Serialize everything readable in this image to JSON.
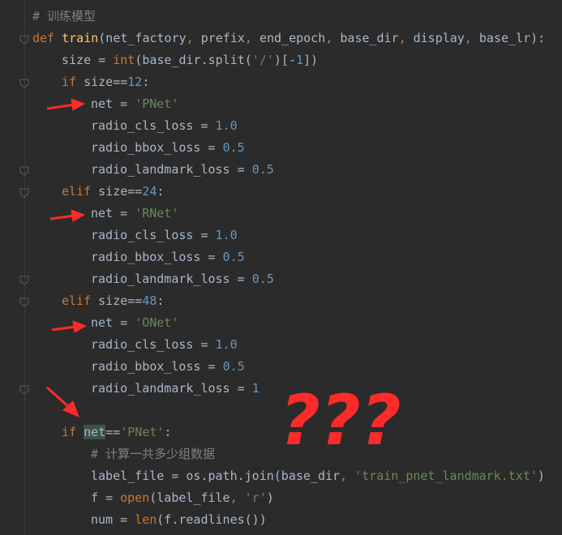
{
  "editor": {
    "lines": [
      {
        "indent": 0,
        "spans": [
          {
            "t": "# 训练模型",
            "c": "cm"
          }
        ]
      },
      {
        "indent": 0,
        "spans": [
          {
            "t": "def ",
            "c": "kw"
          },
          {
            "t": "train",
            "c": "fn"
          },
          {
            "t": "(net_factory",
            "c": ""
          },
          {
            "t": ", ",
            "c": "kw"
          },
          {
            "t": "prefix",
            "c": ""
          },
          {
            "t": ", ",
            "c": "kw"
          },
          {
            "t": "end_epoch",
            "c": ""
          },
          {
            "t": ", ",
            "c": "kw"
          },
          {
            "t": "base_dir",
            "c": ""
          },
          {
            "t": ", ",
            "c": "kw"
          },
          {
            "t": "display",
            "c": ""
          },
          {
            "t": ", ",
            "c": "kw"
          },
          {
            "t": "base_lr):",
            "c": ""
          }
        ]
      },
      {
        "indent": 1,
        "spans": [
          {
            "t": "size = ",
            "c": ""
          },
          {
            "t": "int",
            "c": "kw"
          },
          {
            "t": "(base_dir.split(",
            "c": ""
          },
          {
            "t": "'/'",
            "c": "str"
          },
          {
            "t": ")[-",
            "c": ""
          },
          {
            "t": "1",
            "c": "num"
          },
          {
            "t": "])",
            "c": ""
          }
        ]
      },
      {
        "indent": 1,
        "spans": [
          {
            "t": "if ",
            "c": "kw"
          },
          {
            "t": "size==",
            "c": ""
          },
          {
            "t": "12",
            "c": "num"
          },
          {
            "t": ":",
            "c": ""
          }
        ]
      },
      {
        "indent": 2,
        "spans": [
          {
            "t": "net = ",
            "c": ""
          },
          {
            "t": "'PNet'",
            "c": "str"
          }
        ]
      },
      {
        "indent": 2,
        "spans": [
          {
            "t": "radio_cls_loss = ",
            "c": ""
          },
          {
            "t": "1.0",
            "c": "num"
          }
        ]
      },
      {
        "indent": 2,
        "spans": [
          {
            "t": "radio_bbox_loss = ",
            "c": ""
          },
          {
            "t": "0.5",
            "c": "num"
          }
        ]
      },
      {
        "indent": 2,
        "spans": [
          {
            "t": "radio_landmark_loss = ",
            "c": ""
          },
          {
            "t": "0.5",
            "c": "num"
          }
        ]
      },
      {
        "indent": 1,
        "spans": [
          {
            "t": "elif ",
            "c": "kw"
          },
          {
            "t": "size==",
            "c": ""
          },
          {
            "t": "24",
            "c": "num"
          },
          {
            "t": ":",
            "c": ""
          }
        ]
      },
      {
        "indent": 2,
        "spans": [
          {
            "t": "net = ",
            "c": ""
          },
          {
            "t": "'RNet'",
            "c": "str"
          }
        ]
      },
      {
        "indent": 2,
        "spans": [
          {
            "t": "radio_cls_loss = ",
            "c": ""
          },
          {
            "t": "1.0",
            "c": "num"
          }
        ]
      },
      {
        "indent": 2,
        "spans": [
          {
            "t": "radio_bbox_loss = ",
            "c": ""
          },
          {
            "t": "0.5",
            "c": "num"
          }
        ]
      },
      {
        "indent": 2,
        "spans": [
          {
            "t": "radio_landmark_loss = ",
            "c": ""
          },
          {
            "t": "0.5",
            "c": "num"
          }
        ]
      },
      {
        "indent": 1,
        "spans": [
          {
            "t": "elif ",
            "c": "kw"
          },
          {
            "t": "size==",
            "c": ""
          },
          {
            "t": "48",
            "c": "num"
          },
          {
            "t": ":",
            "c": ""
          }
        ]
      },
      {
        "indent": 2,
        "spans": [
          {
            "t": "net = ",
            "c": ""
          },
          {
            "t": "'ONet'",
            "c": "str"
          }
        ]
      },
      {
        "indent": 2,
        "spans": [
          {
            "t": "radio_cls_loss = ",
            "c": ""
          },
          {
            "t": "1.0",
            "c": "num"
          }
        ]
      },
      {
        "indent": 2,
        "spans": [
          {
            "t": "radio_bbox_loss = ",
            "c": ""
          },
          {
            "t": "0.5",
            "c": "num"
          }
        ]
      },
      {
        "indent": 2,
        "spans": [
          {
            "t": "radio_landmark_loss = ",
            "c": ""
          },
          {
            "t": "1",
            "c": "num"
          }
        ]
      },
      {
        "indent": 0,
        "spans": []
      },
      {
        "indent": 1,
        "spans": [
          {
            "t": "if ",
            "c": "kw"
          },
          {
            "t": "net",
            "c": "hl"
          },
          {
            "t": "==",
            "c": ""
          },
          {
            "t": "'PNet'",
            "c": "str"
          },
          {
            "t": ":",
            "c": ""
          }
        ]
      },
      {
        "indent": 2,
        "spans": [
          {
            "t": "# 计算一共多少组数据",
            "c": "cm"
          }
        ]
      },
      {
        "indent": 2,
        "spans": [
          {
            "t": "label_file = os.path.join(base_dir",
            "c": ""
          },
          {
            "t": ", ",
            "c": "kw"
          },
          {
            "t": "'train_pnet_landmark.txt'",
            "c": "str"
          },
          {
            "t": ")",
            "c": ""
          }
        ]
      },
      {
        "indent": 2,
        "spans": [
          {
            "t": "f = ",
            "c": ""
          },
          {
            "t": "open",
            "c": "kw"
          },
          {
            "t": "(label_file",
            "c": ""
          },
          {
            "t": ", ",
            "c": "kw"
          },
          {
            "t": "'r'",
            "c": "str"
          },
          {
            "t": ")",
            "c": ""
          }
        ]
      },
      {
        "indent": 2,
        "spans": [
          {
            "t": "num = ",
            "c": ""
          },
          {
            "t": "len",
            "c": "kw"
          },
          {
            "t": "(f.readlines())",
            "c": ""
          }
        ]
      }
    ],
    "annotation_text": "???",
    "annotation_color": "#ff2a2a",
    "fold_lines": [
      1,
      3,
      7,
      8,
      12,
      13,
      17
    ]
  }
}
